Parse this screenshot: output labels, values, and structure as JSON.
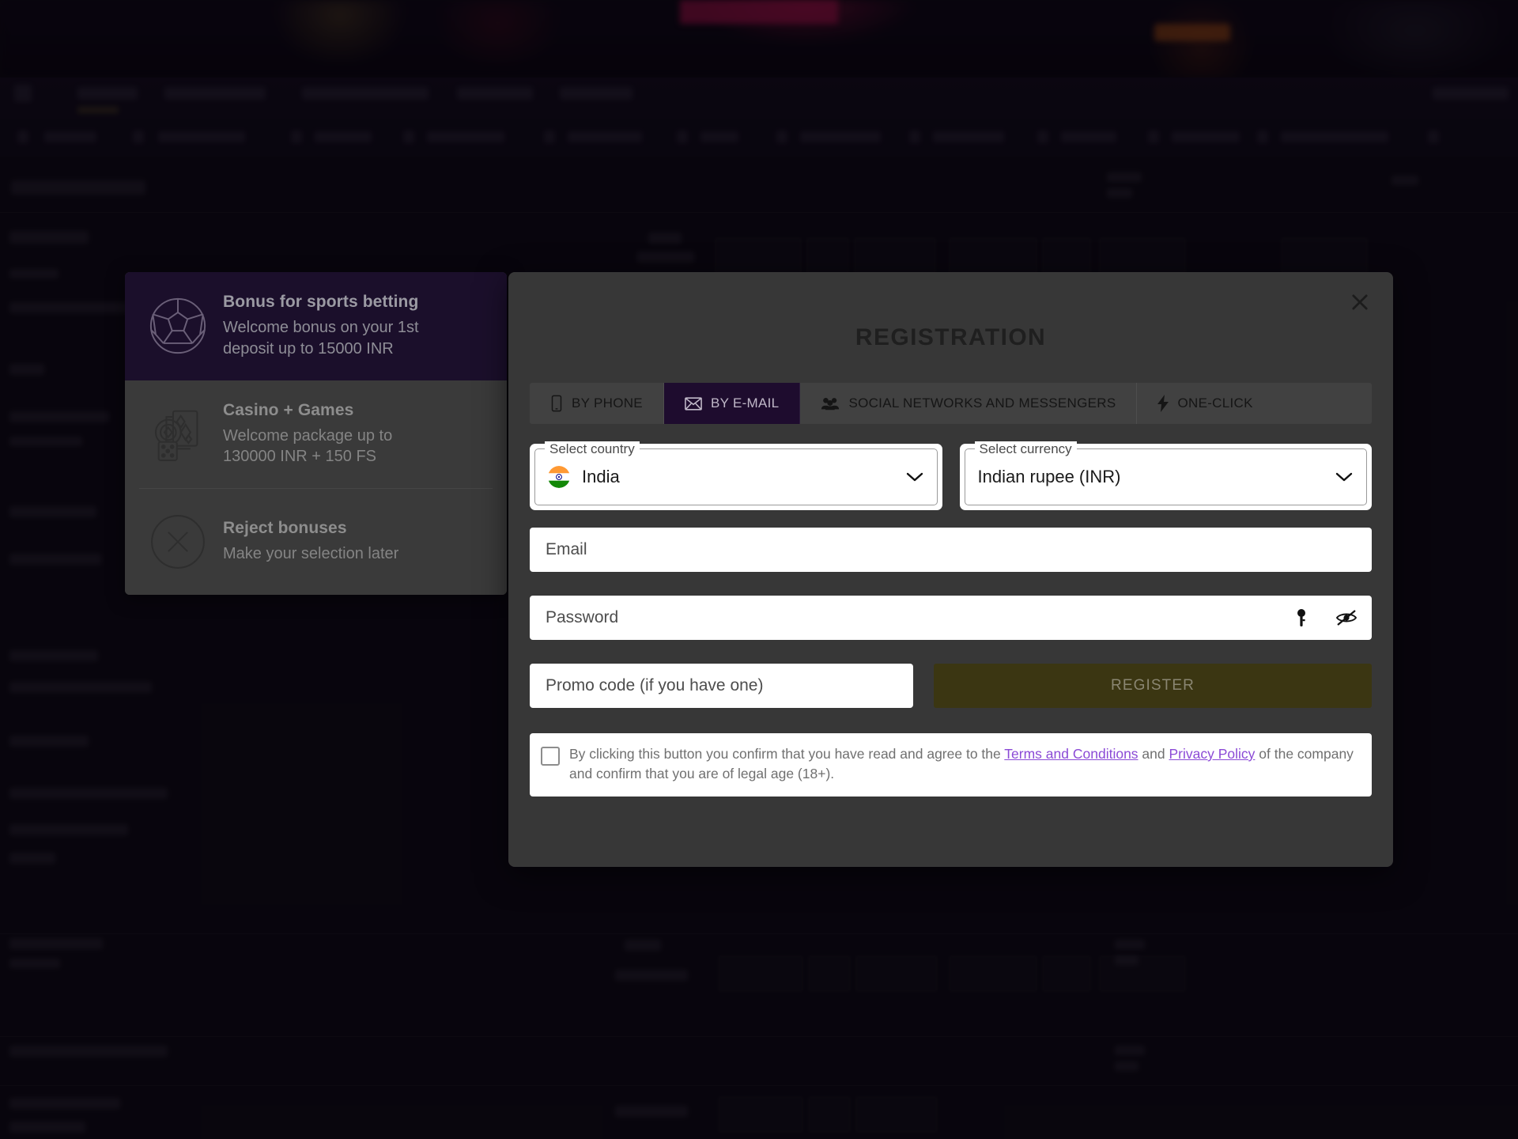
{
  "modal": {
    "title": "REGISTRATION",
    "close_icon": "close-icon",
    "tabs": [
      {
        "label": "BY PHONE",
        "icon": "phone-icon",
        "active": false
      },
      {
        "label": "BY E-MAIL",
        "icon": "envelope-icon",
        "active": true
      },
      {
        "label": "SOCIAL NETWORKS AND MESSENGERS",
        "icon": "people-icon",
        "active": false
      },
      {
        "label": "ONE-CLICK",
        "icon": "lightning-icon",
        "active": false
      }
    ],
    "country": {
      "legend": "Select country",
      "value": "India",
      "flag": "india-flag-icon",
      "chevron": "chevron-down-icon"
    },
    "currency": {
      "legend": "Select currency",
      "value": "Indian rupee (INR)",
      "chevron": "chevron-down-icon"
    },
    "email": {
      "placeholder": "Email",
      "value": ""
    },
    "password": {
      "placeholder": "Password",
      "value": "",
      "generate_icon": "key-icon",
      "toggle_icon": "eye-slash-icon"
    },
    "promo": {
      "placeholder": "Promo code (if you have one)",
      "value": ""
    },
    "register_label": "REGISTER",
    "terms": {
      "checked": false,
      "text_before": "By clicking this button you confirm that you have read and agree to the ",
      "link_terms": "Terms and Conditions",
      "text_mid": " and ",
      "link_privacy": "Privacy Policy",
      "text_after": " of the company and confirm that you are of legal age (18+)."
    }
  },
  "bonus_panel": {
    "cards": [
      {
        "title": "Bonus for sports betting",
        "subtitle": "Welcome bonus on your 1st deposit up to 15000 INR",
        "icon": "soccer-ball-icon",
        "selected": true
      },
      {
        "title": "Casino + Games",
        "subtitle": "Welcome package up to 130000 INR + 150 FS",
        "icon": "casino-chips-cards-icon",
        "selected": false
      },
      {
        "title": "Reject bonuses",
        "subtitle": "Make your selection later",
        "icon": "circle-x-icon",
        "selected": false
      }
    ]
  },
  "colors": {
    "modal_bg": "#373737",
    "tab_active_bg": "#1e0c2e",
    "bonus_selected_bg": "#1b0f2b",
    "bonus_plain_bg": "#3a3a3a",
    "register_button_bg": "#3b3612",
    "link_purple": "#8b4ad6",
    "page_backdrop": "#0f0a16"
  }
}
